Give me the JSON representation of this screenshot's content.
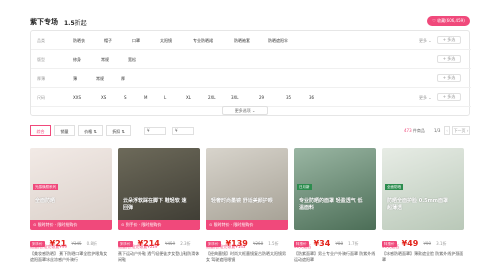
{
  "header": {
    "title": "紫下专场",
    "count": "1.5",
    "count_unit": "折起",
    "follow": "♡ 收藏(606,459)"
  },
  "filters": [
    {
      "label": "品类",
      "options": [
        "防晒衣",
        "帽子",
        "口罩",
        "太阳镜",
        "专业防晒裙",
        "防晒袖套",
        "防晒遮阳伞"
      ],
      "more": "更多 ⌄",
      "multi": "+ 多选"
    },
    {
      "label": "版型",
      "options": [
        "修身",
        "常规",
        "宽松"
      ],
      "more": "",
      "multi": "+ 多选"
    },
    {
      "label": "厚薄",
      "options": [
        "薄",
        "常规",
        "厚"
      ],
      "more": "",
      "multi": "+ 多选"
    },
    {
      "label": "尺码",
      "options": [
        "XXS",
        "XS",
        "S",
        "M",
        "L",
        "XL",
        "2XL",
        "3XL",
        "29",
        "35",
        "36"
      ],
      "more": "更多 ⌄",
      "multi": "+ 多选"
    }
  ],
  "more_options": "更多选项 ⌄",
  "sort": {
    "items": [
      "综合",
      "销量",
      "价格 ⇅",
      "折扣 ⇅"
    ],
    "price_from": "¥",
    "price_to": "¥",
    "count_num": "473",
    "count_unit": "件商品",
    "page": "1/3",
    "prev": "‹",
    "next": "下一页 ›"
  },
  "products": [
    {
      "overlay": "全面防晒",
      "flag": "光感焕颜系列",
      "tag": "⊙ 限时特价 · 限时抢购价",
      "price_tag": "到手价",
      "price": "¥21",
      "orig": "¥345",
      "sold": "0.8折",
      "promo": "限量抢,抢完恢复¥99",
      "title": "【美妆感防晒】 蕉下防晒口罩全脸护眼角女 遮阳面罩冰丝凉感户外骑行",
      "colors": [
        "#f2eae6",
        "#d9cfc8"
      ]
    },
    {
      "overlay": "云朵浮软踩在脚下 鞋轻软 速回弹",
      "flag": "",
      "tag": "⊙ 到手价 · 限时抢购价",
      "price_tag": "到手价",
      "price": "¥214",
      "orig": "¥459",
      "sold": "2.3折",
      "promo": "限量抢,抢完恢复¥229",
      "title": "蕉下运动户外鞋 透气轻便徒步女登山鞋防滑休闲鞋",
      "colors": [
        "#6d6a5a",
        "#3c3a32"
      ]
    },
    {
      "overlay": "轻奢时尚墨镜 舒适美颜护眼",
      "flag": "",
      "tag": "⊙ 限时特价 · 限时抢购价",
      "price_tag": "到手价",
      "price": "¥139",
      "orig": "¥268",
      "sold": "1.5折",
      "promo": "限量抢,抢完恢复¥143",
      "title": "【经典墨镜】时尚大框墨镜复古防晒太阳镜男女 驾驶遮阳眼镜",
      "colors": [
        "#d8d4cc",
        "#a39e92"
      ]
    },
    {
      "overlay": "专业防晒的面罩 轻盈透气 低温面料",
      "flag": "日月新",
      "tag": "",
      "price_tag": "特惠价",
      "price": "¥34",
      "orig": "¥88",
      "sold": "1.7折",
      "promo": "60天最低",
      "title": "【防紫面罩】男士专业户外骑行面罩 防紫外线运动遮阳罩",
      "colors": [
        "#9ab6a3",
        "#4c6e57"
      ]
    },
    {
      "overlay": "防晒全面护脸 0.5mm面罩超薄透",
      "flag": "全面防晒",
      "tag": "",
      "price_tag": "特惠价",
      "price": "¥49",
      "orig": "¥99",
      "sold": "3.1折",
      "promo": "60天最低",
      "title": "【冰感防晒面罩】薄款遮全脸 防紫外线护颈面罩",
      "colors": [
        "#e7ece5",
        "#b9c8b8"
      ]
    }
  ]
}
